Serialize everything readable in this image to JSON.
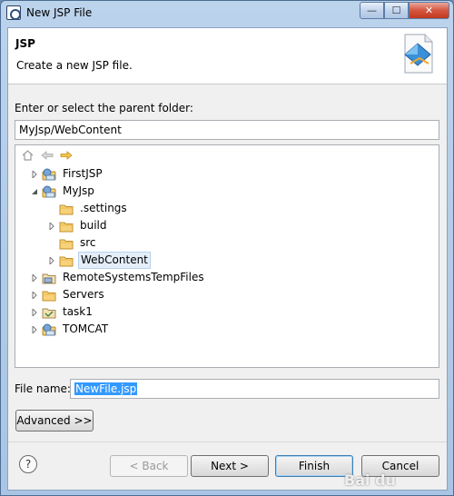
{
  "window": {
    "title": "New JSP File",
    "controls": {
      "minimize": "—",
      "maximize": "☐",
      "close": "✕"
    }
  },
  "banner": {
    "title": "JSP",
    "description": "Create a new JSP file."
  },
  "parent_folder": {
    "label": "Enter or select the parent folder:",
    "value": "MyJsp/WebContent"
  },
  "tree": {
    "toolbar": [
      "home-icon",
      "back-arrow-icon",
      "forward-arrow-icon"
    ],
    "items": [
      {
        "label": "FirstJSP",
        "icon": "web-project-icon",
        "expanded": false
      },
      {
        "label": "MyJsp",
        "icon": "web-project-icon",
        "expanded": true
      },
      {
        "label": ".settings",
        "icon": "folder-icon",
        "expanded": null
      },
      {
        "label": "build",
        "icon": "folder-icon",
        "expanded": false
      },
      {
        "label": "src",
        "icon": "folder-icon",
        "expanded": null
      },
      {
        "label": "WebContent",
        "icon": "folder-icon",
        "expanded": false,
        "selected": true
      },
      {
        "label": "RemoteSystemsTempFiles",
        "icon": "project-icon",
        "expanded": false
      },
      {
        "label": "Servers",
        "icon": "folder-icon",
        "expanded": false
      },
      {
        "label": "task1",
        "icon": "project-icon",
        "expanded": false
      },
      {
        "label": "TOMCAT",
        "icon": "web-project-icon",
        "expanded": false
      }
    ]
  },
  "file_name": {
    "label": "File name:",
    "value": "NewFile.jsp"
  },
  "buttons": {
    "advanced": "Advanced >>",
    "help": "?",
    "back": "< Back",
    "next": "Next >",
    "finish": "Finish",
    "cancel": "Cancel"
  },
  "watermark": "Bai du"
}
